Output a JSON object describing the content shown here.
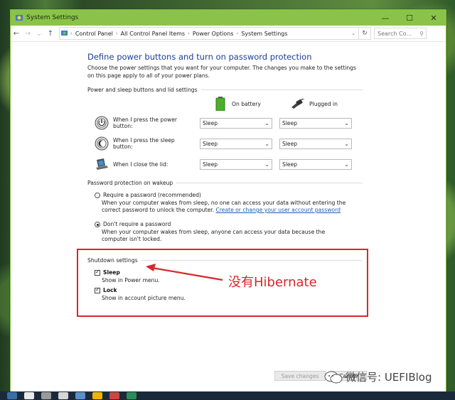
{
  "window": {
    "title": "System Settings",
    "controls": {
      "minimize": "—",
      "maximize": "☐",
      "close": "✕"
    }
  },
  "address_bar": {
    "crumbs": [
      "Control Panel",
      "All Control Panel Items",
      "Power Options",
      "System Settings"
    ],
    "search_placeholder": "Search Co..."
  },
  "page": {
    "heading": "Define power buttons and turn on password protection",
    "intro": "Choose the power settings that you want for your computer. The changes you make to the settings on this page apply to all of your power plans."
  },
  "buttons_section": {
    "title": "Power and sleep buttons and lid settings",
    "col_on_battery": "On battery",
    "col_plugged_in": "Plugged in",
    "rows": [
      {
        "label": "When I press the power button:",
        "on_battery": "Sleep",
        "plugged_in": "Sleep",
        "icon": "power-button-icon"
      },
      {
        "label": "When I press the sleep button:",
        "on_battery": "Sleep",
        "plugged_in": "Sleep",
        "icon": "sleep-button-icon"
      },
      {
        "label": "When I close the lid:",
        "on_battery": "Sleep",
        "plugged_in": "Sleep",
        "icon": "laptop-lid-icon"
      }
    ]
  },
  "password_section": {
    "title": "Password protection on wakeup",
    "require": {
      "label": "Require a password (recommended)",
      "desc": "When your computer wakes from sleep, no one can access your data without entering the correct password to unlock the computer.",
      "link": "Create or change your user account password",
      "checked": false
    },
    "no_require": {
      "label": "Don't require a password",
      "desc": "When your computer wakes from sleep, anyone can access your data because the computer isn't locked.",
      "checked": true
    }
  },
  "shutdown_section": {
    "title": "Shutdown settings",
    "items": [
      {
        "label": "Sleep",
        "desc": "Show in Power menu.",
        "checked": true
      },
      {
        "label": "Lock",
        "desc": "Show in account picture menu.",
        "checked": true
      }
    ]
  },
  "annotation": {
    "text": "没有Hibernate",
    "color": "#d9262b"
  },
  "footer": {
    "save": "Save changes",
    "cancel": "Cancel"
  },
  "watermark": {
    "text": "微信号: UEFIBlog"
  },
  "colors": {
    "titlebar": "#8bc34a",
    "heading": "#1e3d9a",
    "link": "#1a5fb4",
    "highlight": "#d9262b"
  }
}
